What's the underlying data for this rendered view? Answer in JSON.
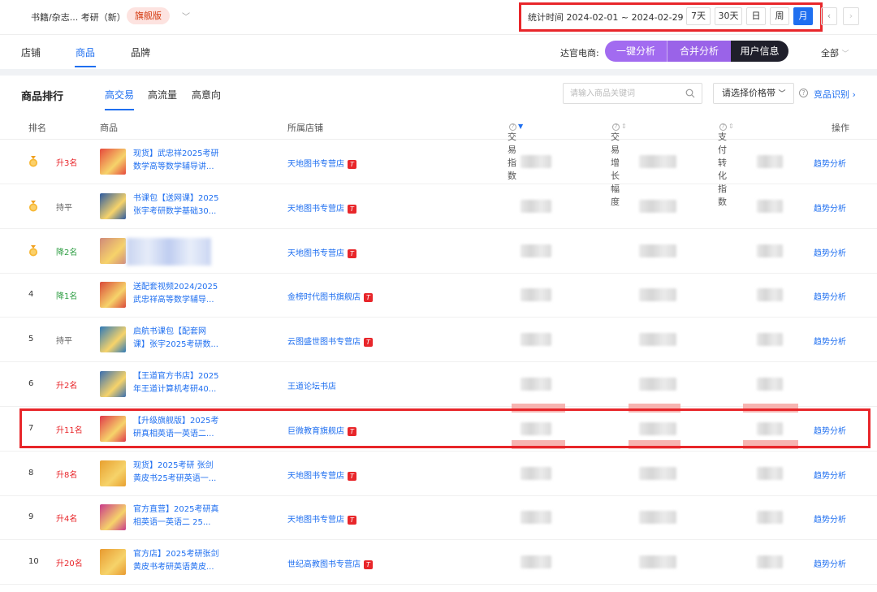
{
  "header": {
    "category": "书籍/杂志... 考研（新）",
    "badge": "旗舰版",
    "date_label": "统计时间 2024-02-01 ~ 2024-02-29",
    "periods": [
      "7天",
      "30天",
      "日",
      "周",
      "月"
    ],
    "active_period": "月"
  },
  "tabs_main": [
    "店铺",
    "商品",
    "品牌"
  ],
  "active_tab_main": "商品",
  "daguan": {
    "label": "达官电商:",
    "buttons": [
      "一键分析",
      "合并分析",
      "用户信息"
    ]
  },
  "all_label": "全部",
  "section": {
    "title": "商品排行",
    "tabs": [
      "高交易",
      "高流量",
      "高意向"
    ],
    "active_tab": "高交易",
    "search_placeholder": "请输入商品关键词",
    "price_select": "请选择价格带",
    "competitor_link": "竞品识别"
  },
  "table": {
    "headers": [
      "排名",
      "商品",
      "所属店铺",
      "交易指数",
      "交易增长幅度",
      "支付转化指数",
      "操作"
    ],
    "rows": [
      {
        "rank": "1",
        "medal": true,
        "trend": "升3名",
        "trend_type": "up",
        "name1": "现货】武忠祥2025考研",
        "name2": "数学高等数学辅导讲...",
        "shop": "天地图书专营店",
        "tmall": true,
        "action": "趋势分析",
        "thumb": "#e64a3d"
      },
      {
        "rank": "2",
        "medal": true,
        "trend": "持平",
        "trend_type": "flat",
        "name1": "书课包【送网课】2025",
        "name2": "张宇考研数学基础30...",
        "shop": "天地图书专营店",
        "tmall": true,
        "action": "趋势分析",
        "thumb": "#2c5aa0"
      },
      {
        "rank": "3",
        "medal": true,
        "trend": "降2名",
        "trend_type": "down",
        "name1": "",
        "name2": "",
        "shop": "天地图书专营店",
        "tmall": true,
        "action": "趋势分析",
        "thumb": "#d08a7a"
      },
      {
        "rank": "4",
        "medal": false,
        "trend": "降1名",
        "trend_type": "down",
        "name1": "送配套视频2024/2025",
        "name2": "武忠祥高等数学辅导...",
        "shop": "金榜时代图书旗舰店",
        "tmall": true,
        "action": "趋势分析",
        "thumb": "#d94a3a"
      },
      {
        "rank": "5",
        "medal": false,
        "trend": "持平",
        "trend_type": "flat",
        "name1": "启航书课包【配套网",
        "name2": "课】张宇2025考研数...",
        "shop": "云图盛世图书专营店",
        "tmall": true,
        "action": "趋势分析",
        "thumb": "#2f7ab8"
      },
      {
        "rank": "6",
        "medal": false,
        "trend": "升2名",
        "trend_type": "up",
        "name1": "【王道官方书店】2025",
        "name2": "年王道计算机考研40...",
        "shop": "王道论坛书店",
        "tmall": false,
        "action": "",
        "thumb": "#3a6fb0"
      },
      {
        "rank": "7",
        "medal": false,
        "trend": "升11名",
        "trend_type": "up",
        "name1": "【升级旗舰版】2025考",
        "name2": "研真相英语一英语二...",
        "shop": "巨微教育旗舰店",
        "tmall": true,
        "action": "趋势分析",
        "thumb": "#e03a4a"
      },
      {
        "rank": "8",
        "medal": false,
        "trend": "升8名",
        "trend_type": "up",
        "name1": "现货】2025考研 张剑",
        "name2": "黄皮书25考研英语一...",
        "shop": "天地图书专营店",
        "tmall": true,
        "action": "趋势分析",
        "thumb": "#e8a030"
      },
      {
        "rank": "9",
        "medal": false,
        "trend": "升4名",
        "trend_type": "up",
        "name1": "官方直营】2025考研真",
        "name2": "相英语一英语二 25...",
        "shop": "天地图书专营店",
        "tmall": true,
        "action": "趋势分析",
        "thumb": "#c93a8a"
      },
      {
        "rank": "10",
        "medal": false,
        "trend": "升20名",
        "trend_type": "up",
        "name1": "官方店】2025考研张剑",
        "name2": "黄皮书考研英语黄皮...",
        "shop": "世纪高教图书专营店",
        "tmall": true,
        "action": "趋势分析",
        "thumb": "#e89a30"
      }
    ]
  },
  "colors": {
    "accent": "#1f6ff0",
    "highlight": "#e8262a",
    "up": "#e8262a",
    "down": "#2f9e44"
  }
}
